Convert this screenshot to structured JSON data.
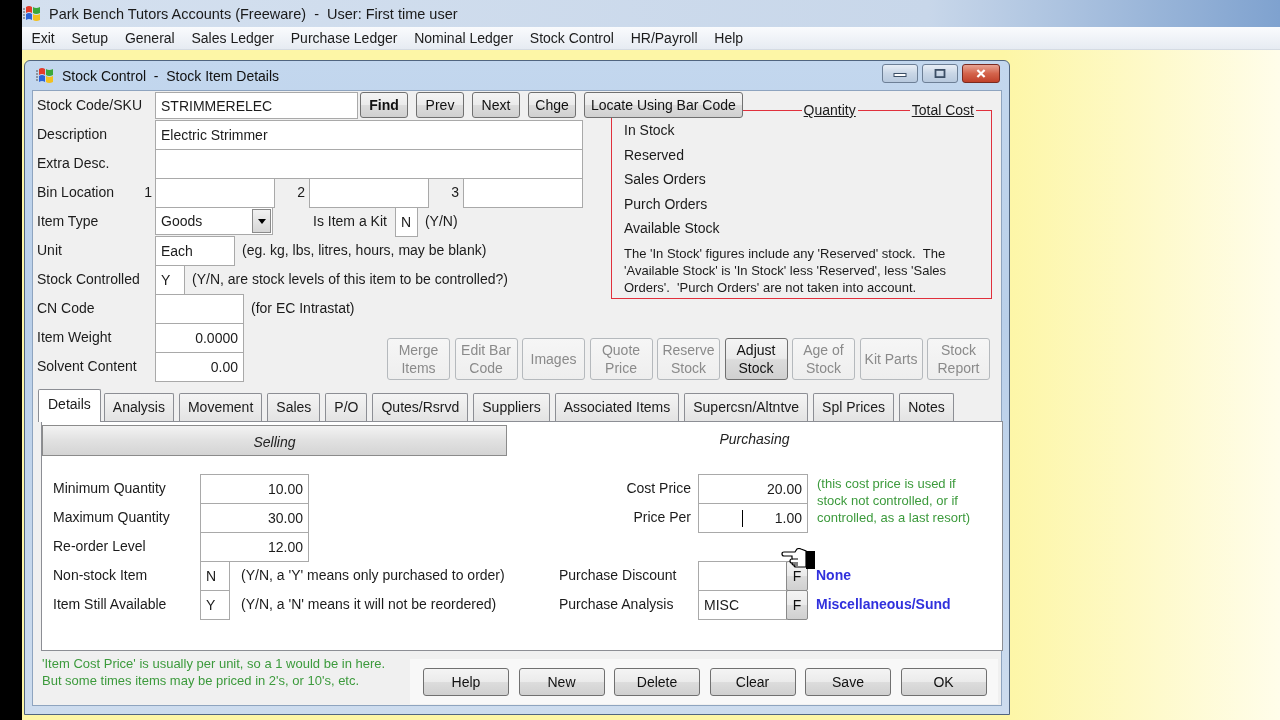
{
  "app": {
    "title": "Park Bench Tutors Accounts (Freeware)  -  User: First time user"
  },
  "menu": [
    {
      "label": "Exit"
    },
    {
      "label": "Setup"
    },
    {
      "label": "General"
    },
    {
      "label": "Sales Ledger"
    },
    {
      "label": "Purchase Ledger"
    },
    {
      "label": "Nominal Ledger"
    },
    {
      "label": "Stock Control"
    },
    {
      "label": "HR/Payroll"
    },
    {
      "label": "Help"
    }
  ],
  "window": {
    "title": "Stock Control  -  Stock Item Details"
  },
  "stock_code": {
    "label": "Stock Code/SKU",
    "value": "STRIMMERELEC"
  },
  "nav_buttons": [
    {
      "label": "Find",
      "default": true
    },
    {
      "label": "Prev",
      "default": false
    },
    {
      "label": "Next",
      "default": false
    },
    {
      "label": "Chge",
      "default": false
    },
    {
      "label": "Locate Using Bar Code",
      "default": false
    }
  ],
  "fields": [
    {
      "kind": "wide",
      "label": "Description",
      "value": "Electric Strimmer"
    },
    {
      "kind": "wide",
      "label": "Extra Desc."
    },
    {
      "kind": "bins",
      "label": "Bin Location",
      "bins": [
        {
          "number": "1"
        },
        {
          "number": "2"
        },
        {
          "number": "3"
        }
      ]
    },
    {
      "kind": "combo",
      "label": "Item Type",
      "value": "Goods",
      "kit": {
        "label": "Is Item a Kit",
        "value": "N",
        "hint": "(Y/N)"
      }
    },
    {
      "kind": "narrow",
      "label": "Unit",
      "value": "Each",
      "hint": "(eg. kg, lbs, litres, hours, may be blank)"
    },
    {
      "kind": "flag",
      "label": "Stock Controlled",
      "value": "Y",
      "hint": "(Y/N, are stock levels of this item to be controlled?)"
    },
    {
      "kind": "short",
      "label": "CN Code",
      "hint": "(for EC Intrastat)"
    }
  ],
  "measures": [
    {
      "label": "Item Weight",
      "value": "0.0000"
    },
    {
      "label": "Solvent Content",
      "value": "0.00"
    }
  ],
  "stock_summary": {
    "columns": [
      "Quantity",
      "Total Cost"
    ],
    "rows": [
      "In Stock",
      "Reserved",
      "Sales Orders",
      "Purch Orders",
      "Available Stock"
    ],
    "note": "The 'In Stock' figures include any 'Reserved' stock.  The 'Available Stock' is 'In Stock' less 'Reserved', less 'Sales Orders'.  'Purch Orders' are not taken into account."
  },
  "actions": [
    {
      "label": "Merge Items",
      "disabled": true
    },
    {
      "label": "Edit Bar Code",
      "disabled": true
    },
    {
      "label": "Images",
      "disabled": true
    },
    {
      "label": "Quote Price",
      "disabled": true
    },
    {
      "label": "Reserve Stock",
      "disabled": true
    },
    {
      "label": "Adjust Stock",
      "disabled": false
    },
    {
      "label": "Age of Stock",
      "disabled": true
    },
    {
      "label": "Kit Parts",
      "disabled": true
    },
    {
      "label": "Stock Report",
      "disabled": true
    }
  ],
  "tabs": [
    {
      "label": "Details",
      "selected": true
    },
    {
      "label": "Analysis",
      "selected": false
    },
    {
      "label": "Movement",
      "selected": false
    },
    {
      "label": "Sales",
      "selected": false
    },
    {
      "label": "P/O",
      "selected": false
    },
    {
      "label": "Qutes/Rsrvd",
      "selected": false
    },
    {
      "label": "Suppliers",
      "selected": false
    },
    {
      "label": "Associated Items",
      "selected": false
    },
    {
      "label": "Supercsn/Altntve",
      "selected": false
    },
    {
      "label": "Spl Prices",
      "selected": false
    },
    {
      "label": "Notes",
      "selected": false
    }
  ],
  "sections": [
    {
      "label": "Selling",
      "selected": false
    },
    {
      "label": "Purchasing",
      "selected": true
    }
  ],
  "selling": {
    "quantities": [
      {
        "label": "Minimum Quantity",
        "value": "10.00"
      },
      {
        "label": "Maximum Quantity",
        "value": "30.00"
      },
      {
        "label": "Re-order Level",
        "value": "12.00"
      }
    ],
    "flags": [
      {
        "label": "Non-stock Item",
        "value": "N",
        "hint": "(Y/N, a 'Y' means only purchased to order)"
      },
      {
        "label": "Item Still Available",
        "value": "Y",
        "hint": "(Y/N, a 'N' means it will not be reordered)"
      }
    ]
  },
  "purchasing": {
    "prices": [
      {
        "label": "Cost Price",
        "value": "20.00",
        "focused": false
      },
      {
        "label": "Price Per",
        "value": "1.00",
        "focused": true
      }
    ],
    "price_note": "(this cost price is used if stock not controlled, or if controlled, as a last resort)",
    "lookups": [
      {
        "label": "Purchase Discount",
        "button": "F",
        "description": "None"
      },
      {
        "label": "Purchase Analysis",
        "value": "MISC",
        "button": "F",
        "description": "Miscellaneous/Sund"
      }
    ]
  },
  "footer_note": "'Item Cost Price' is usually per unit, so a 1 would be in here. But some times items may be priced in 2's, or 10's, etc.",
  "buttons": [
    {
      "label": "Help"
    },
    {
      "label": "New"
    },
    {
      "label": "Delete"
    },
    {
      "label": "Clear"
    },
    {
      "label": "Save"
    },
    {
      "label": "OK"
    }
  ]
}
